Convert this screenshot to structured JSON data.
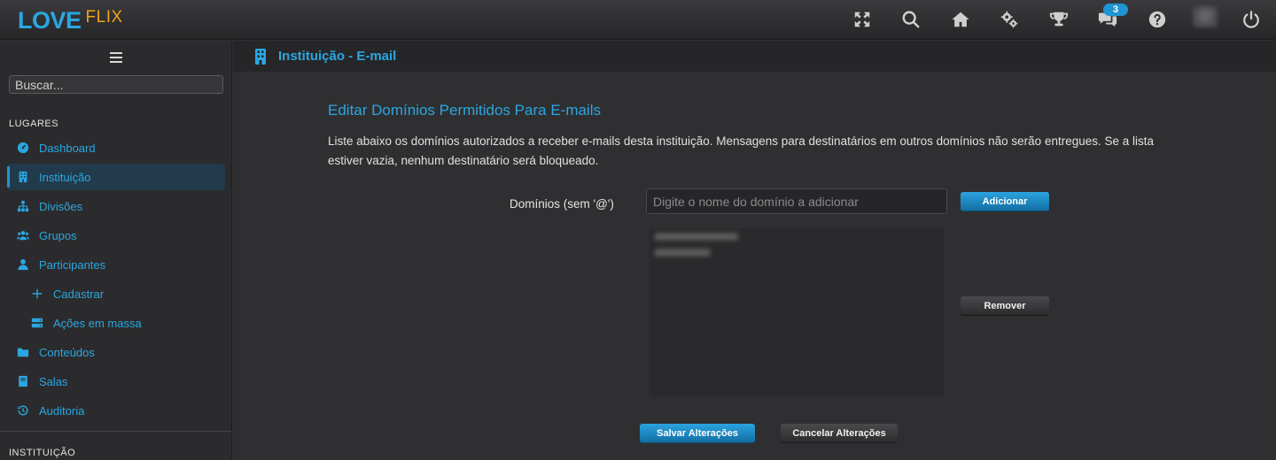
{
  "app": {
    "logo_love": "LOVE",
    "logo_flix": "FLIX",
    "notification_count": "3",
    "top_icons": [
      "fullscreen-icon",
      "search-icon",
      "home-icon",
      "settings-gears-icon",
      "trophy-icon",
      "chat-icon",
      "help-icon",
      "avatar",
      "power-icon"
    ]
  },
  "sidebar": {
    "search_placeholder": "Buscar...",
    "section_lugares": "LUGARES",
    "section_instituicao": "INSTITUIÇÃO",
    "items": [
      {
        "label": "Dashboard",
        "icon": "dashboard-icon"
      },
      {
        "label": "Instituição",
        "icon": "building-icon",
        "active": true
      },
      {
        "label": "Divisões",
        "icon": "sitemap-icon"
      },
      {
        "label": "Grupos",
        "icon": "users-icon"
      },
      {
        "label": "Participantes",
        "icon": "user-icon"
      },
      {
        "label": "Cadastrar",
        "icon": "plus-icon",
        "sub": true
      },
      {
        "label": "Ações em massa",
        "icon": "server-icon",
        "sub": true
      },
      {
        "label": "Conteúdos",
        "icon": "folder-icon"
      },
      {
        "label": "Salas",
        "icon": "book-icon"
      },
      {
        "label": "Auditoria",
        "icon": "history-icon"
      }
    ]
  },
  "header": {
    "title": "Instituição - E-mail"
  },
  "form": {
    "title": "Editar Domínios Permitidos Para E-mails",
    "description": "Liste abaixo os domínios autorizados a receber e-mails desta instituição. Mensagens para destinatários em outros domínios não serão entregues. Se a lista estiver vazia, nenhum destinatário será bloqueado.",
    "domain_label": "Domínios (sem '@')",
    "domain_placeholder": "Digite o nome do domínio a adicionar",
    "add_button": "Adicionar",
    "remove_button": "Remover",
    "save_button": "Salvar Alterações",
    "cancel_button": "Cancelar Alterações"
  },
  "colors": {
    "accent": "#2aa7e1",
    "logo_secondary": "#f0a317",
    "active_bg": "#213b4c"
  }
}
